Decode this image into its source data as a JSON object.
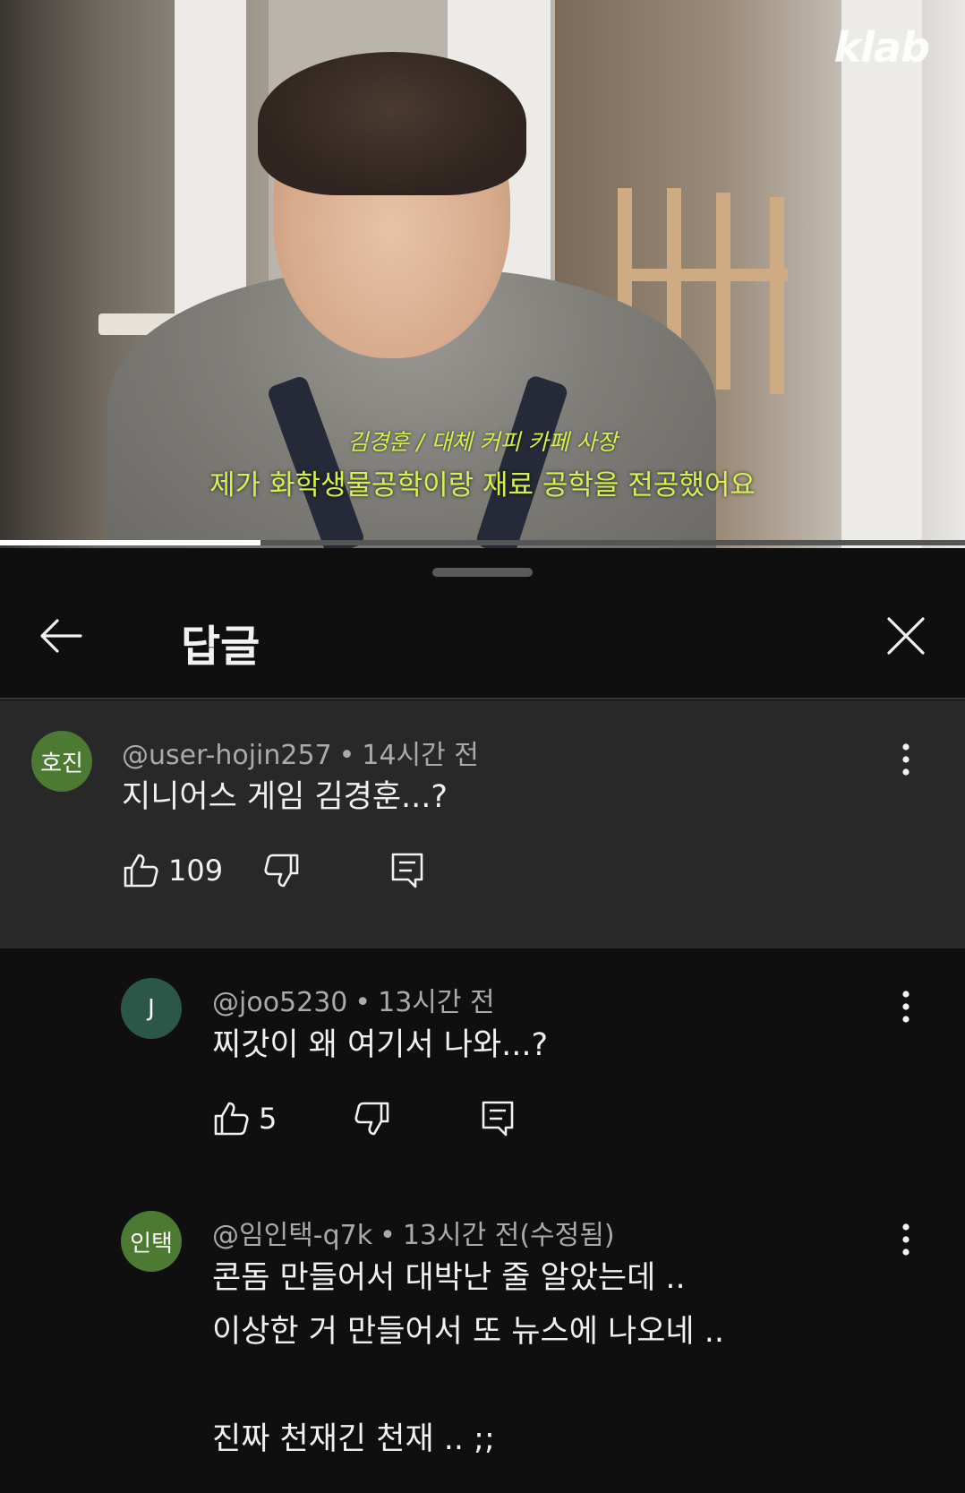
{
  "video": {
    "logo": "klab",
    "subtitle_name": "김경훈 / 대체 커피 카페 사장",
    "subtitle_line": "제가 화학생물공학이랑 재료 공학을 전공했어요",
    "progress_fraction": 0.27
  },
  "sheet": {
    "title": "답글",
    "back_icon": "arrow-left-icon",
    "close_icon": "close-icon"
  },
  "parent_comment": {
    "avatar_text": "호진",
    "avatar_color": "#4c7a32",
    "author": "@user-hojin257",
    "time": "14시간 전",
    "text": "지니어스 게임 김경훈...?",
    "likes": "109"
  },
  "replies": [
    {
      "avatar_text": "J",
      "avatar_color": "#2c5748",
      "author": "@joo5230",
      "time": "13시간 전",
      "lines": [
        "찌갓이 왜 여기서 나와...?"
      ],
      "likes": "5"
    },
    {
      "avatar_text": "인택",
      "avatar_color": "#4c7a32",
      "author": "@임인택-q7k",
      "time": "13시간 전(수정됨)",
      "lines": [
        "콘돔 만들어서 대박난 줄 알았는데 ..",
        "이상한 거 만들어서 또 뉴스에 나오네 ..",
        "",
        "진짜 천재긴 천재 .. ;;"
      ]
    }
  ],
  "separator": "•"
}
